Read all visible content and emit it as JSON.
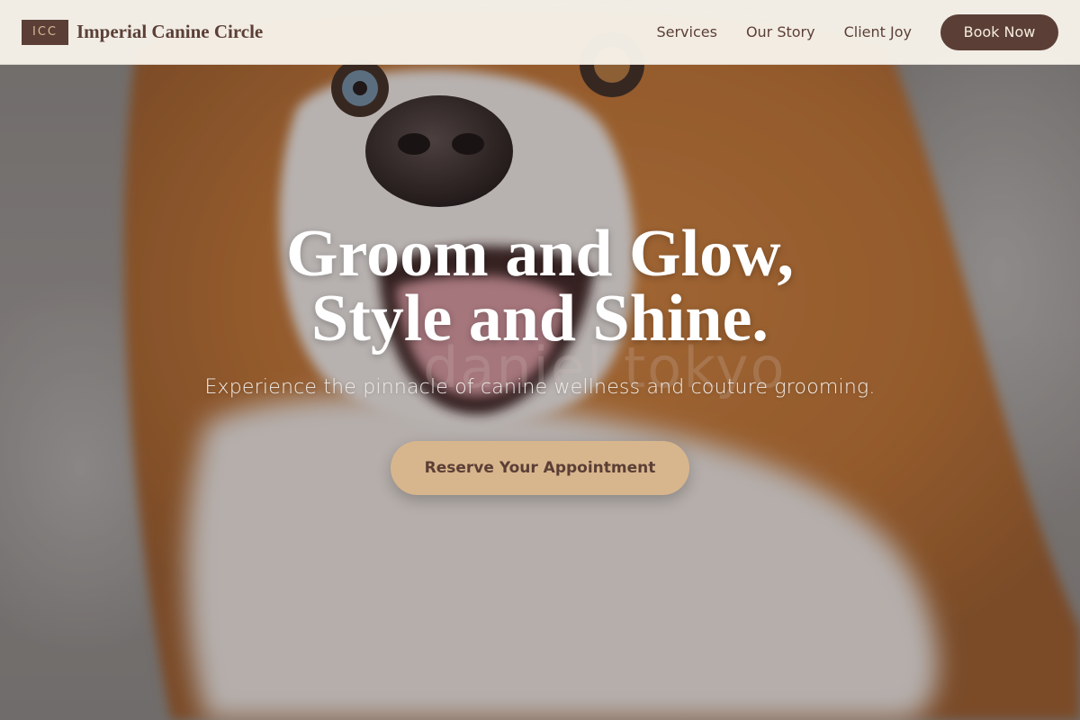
{
  "brand": {
    "logo_text": "ICC",
    "name": "Imperial Canine Circle"
  },
  "nav": {
    "links": [
      "Services",
      "Our Story",
      "Client Joy"
    ],
    "book_label": "Book Now"
  },
  "hero": {
    "headline_line1": "Groom and Glow,",
    "headline_line2": "Style and Shine.",
    "subheadline": "Experience the pinnacle of canine wellness and couture grooming.",
    "cta_label": "Reserve Your Appointment",
    "watermark": "daniel tokyo",
    "image_subject": "smiling corgi dog"
  },
  "colors": {
    "brand_brown": "#5b3f36",
    "header_bg": "#f7f3ea",
    "cta_tan": "#d8b68d",
    "accent_gold": "#d8b894"
  }
}
